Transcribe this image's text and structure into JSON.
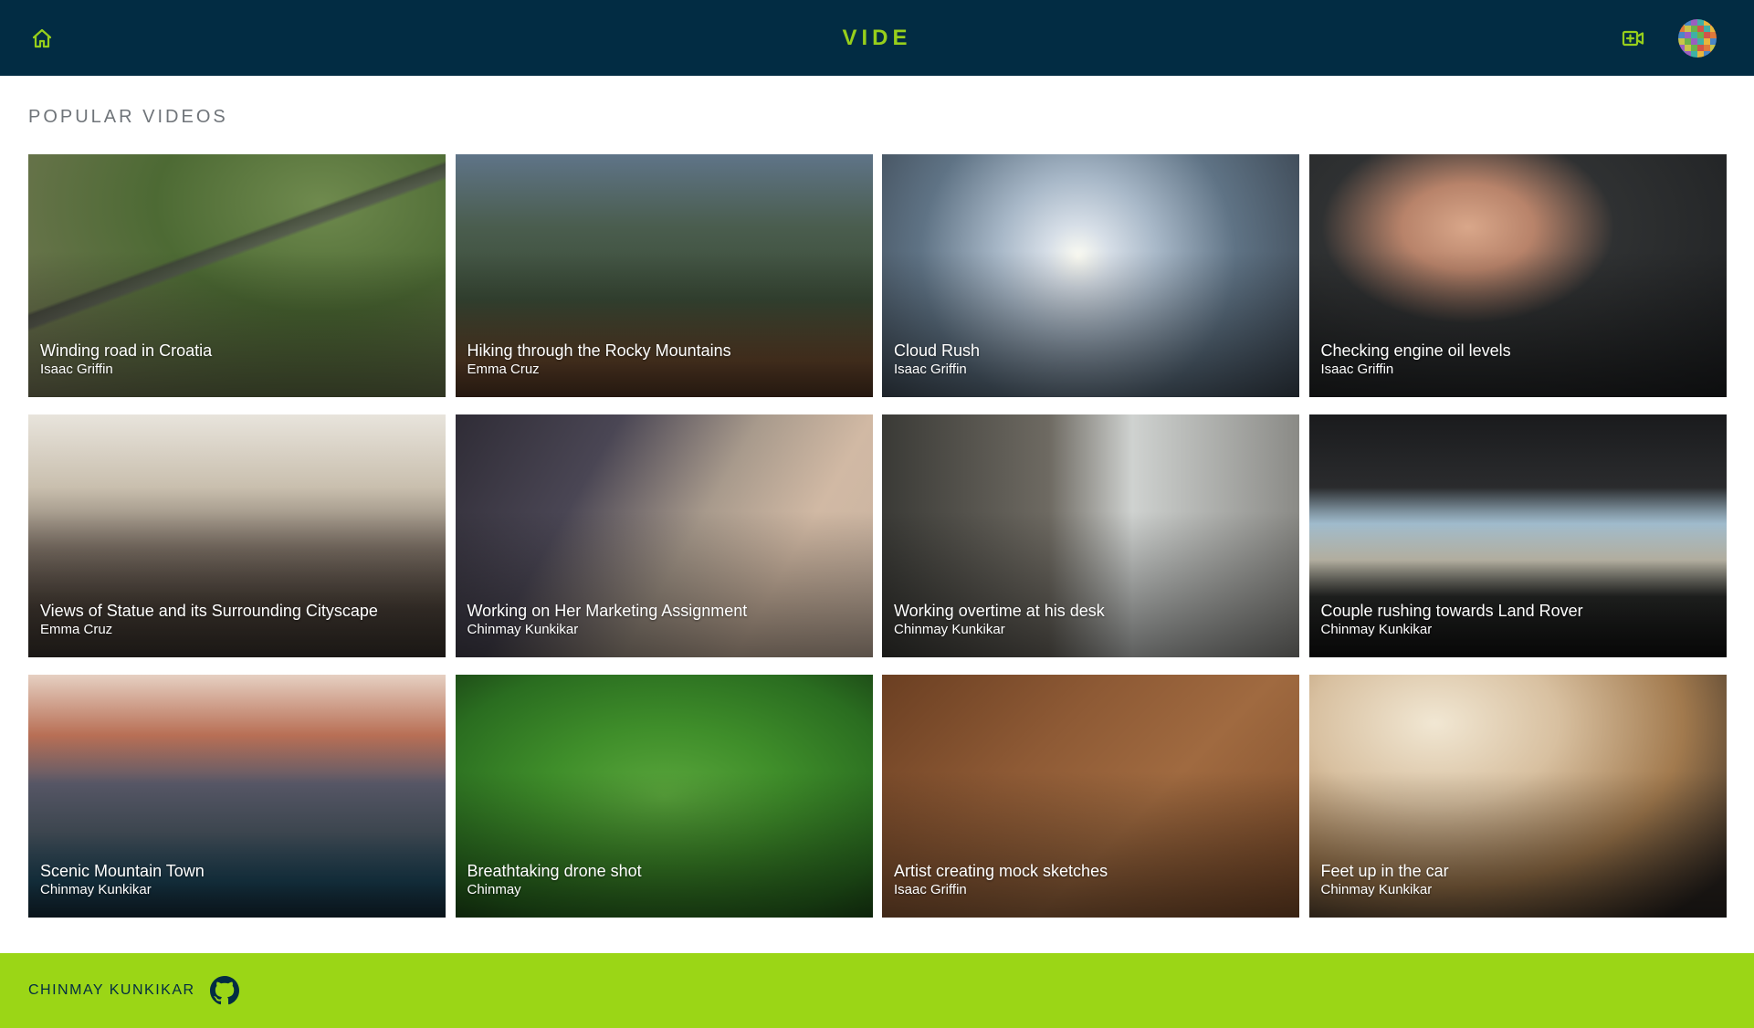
{
  "header": {
    "brand": "VIDE",
    "home_icon": "home-icon",
    "upload_icon": "video-add-icon",
    "avatar_icon": "avatar",
    "colors": {
      "background": "#022c43",
      "accent": "#97cf1b"
    }
  },
  "main": {
    "section_title": "POPULAR VIDEOS",
    "videos": [
      {
        "title": "Winding road in Croatia",
        "author": "Isaac Griffin"
      },
      {
        "title": "Hiking through the Rocky Mountains",
        "author": "Emma Cruz"
      },
      {
        "title": "Cloud Rush",
        "author": "Isaac Griffin"
      },
      {
        "title": "Checking engine oil levels",
        "author": "Isaac Griffin"
      },
      {
        "title": "Views of Statue and its Surrounding Cityscape",
        "author": "Emma Cruz"
      },
      {
        "title": "Working on Her Marketing Assignment",
        "author": "Chinmay Kunkikar"
      },
      {
        "title": "Working overtime at his desk",
        "author": "Chinmay Kunkikar"
      },
      {
        "title": "Couple rushing towards Land Rover",
        "author": "Chinmay Kunkikar"
      },
      {
        "title": "Scenic Mountain Town",
        "author": "Chinmay Kunkikar"
      },
      {
        "title": "Breathtaking drone shot",
        "author": "Chinmay"
      },
      {
        "title": "Artist creating mock sketches",
        "author": "Isaac Griffin"
      },
      {
        "title": "Feet up in the car",
        "author": "Chinmay Kunkikar"
      }
    ]
  },
  "footer": {
    "name": "CHINMAY KUNKIKAR",
    "github_icon": "github-icon",
    "colors": {
      "background": "#9bd616",
      "text": "#022c43"
    }
  }
}
